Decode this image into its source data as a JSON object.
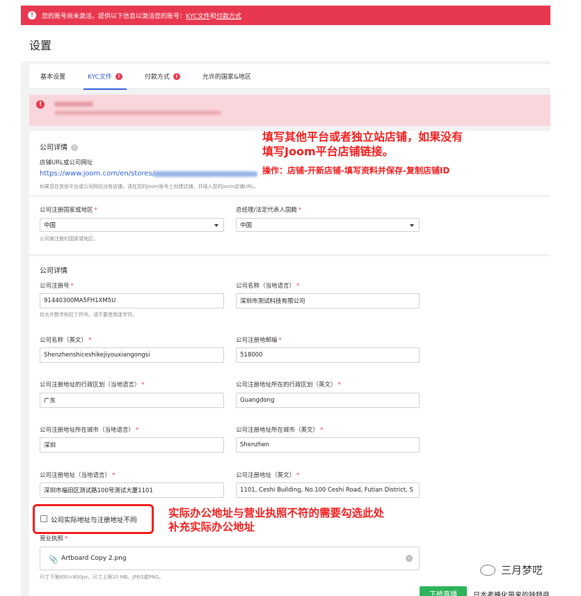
{
  "alert": {
    "text": "您的账号尚未激活。提供以下信息以激活您的账号：",
    "link1": "KYC文件",
    "and": "和",
    "link2": "付款方式"
  },
  "page_title": "设置",
  "tabs": [
    {
      "label": "基本设置",
      "badge": ""
    },
    {
      "label": "KYC文件",
      "badge": "!"
    },
    {
      "label": "付款方式",
      "badge": "!"
    },
    {
      "label": "允许的国家&地区",
      "badge": ""
    }
  ],
  "company_details": {
    "title": "公司详情",
    "store_url_label": "店铺URL或公司网址",
    "store_url_value": "https://www.joom.com/en/stores/",
    "store_url_hint": "如果您在其他平台或公司网站没有店铺，请在您的Joom账号上创建店铺，并填入您的Joom店铺URL。"
  },
  "annotations": {
    "a1_line1": "填写其他平台或者独立站店铺，如果没有",
    "a1_line2": "填写Joom平台店铺链接。",
    "a2": "操作：店铺-开新店铺-填写资料并保存-复制店铺ID",
    "a3_line1": "实际办公地址与营业执照不符的需要勾选此处",
    "a3_line2": "补充实际办公地址"
  },
  "country": {
    "reg_label": "公司注册国家或地区",
    "reg_value": "中国",
    "reg_hint": "公司被注册的国家或地区。",
    "gm_label": "总经理/法定代表人国籍",
    "gm_value": "中国"
  },
  "details": {
    "title": "公司详情",
    "reg_no_label": "公司注册号",
    "reg_no_value": "91440300MA5FH1XM5U",
    "reg_no_hint": "仅允许数字和拉丁符号。请不要使用连字符。",
    "name_local_label": "公司名称（当地语言）",
    "name_local_value": "深圳市测试科技有限公司",
    "name_en_label": "公司名称（英文）",
    "name_en_value": "Shenzhenshiceshikejiyouxiangongsi",
    "postcode_label": "公司注册地邮编",
    "postcode_value": "518000",
    "region_local_label": "公司注册地址的行政区划（当地语言）",
    "region_local_value": "广东",
    "region_en_label": "公司注册地址所在的行政区划（英文）",
    "region_en_value": "Guangdong",
    "city_local_label": "公司注册地址所在城市（当地语言）",
    "city_local_value": "深圳",
    "city_en_label": "公司注册地址所在城市（英文）",
    "city_en_value": "Shenzhen",
    "addr_local_label": "公司注册地址（当地语言）",
    "addr_local_value": "深圳市福田区测试路100号测试大厦1101",
    "addr_en_label": "公司注册地址（英文）",
    "addr_en_value": "1101, Ceshi Building, No.100 Ceshi Road, Futian District, S",
    "checkbox_label": "公司实际地址与注册地址不同",
    "license_label": "营业执照",
    "license_file": "Artboard Copy 2.png",
    "license_hint": "尺寸下限800×800px，尺寸上限10 MB。JPEG或PNG。"
  },
  "watermark": "三月梦呓",
  "bottom": {
    "button": "下桥直播",
    "text": "日本老蜂化带来的独特商"
  }
}
